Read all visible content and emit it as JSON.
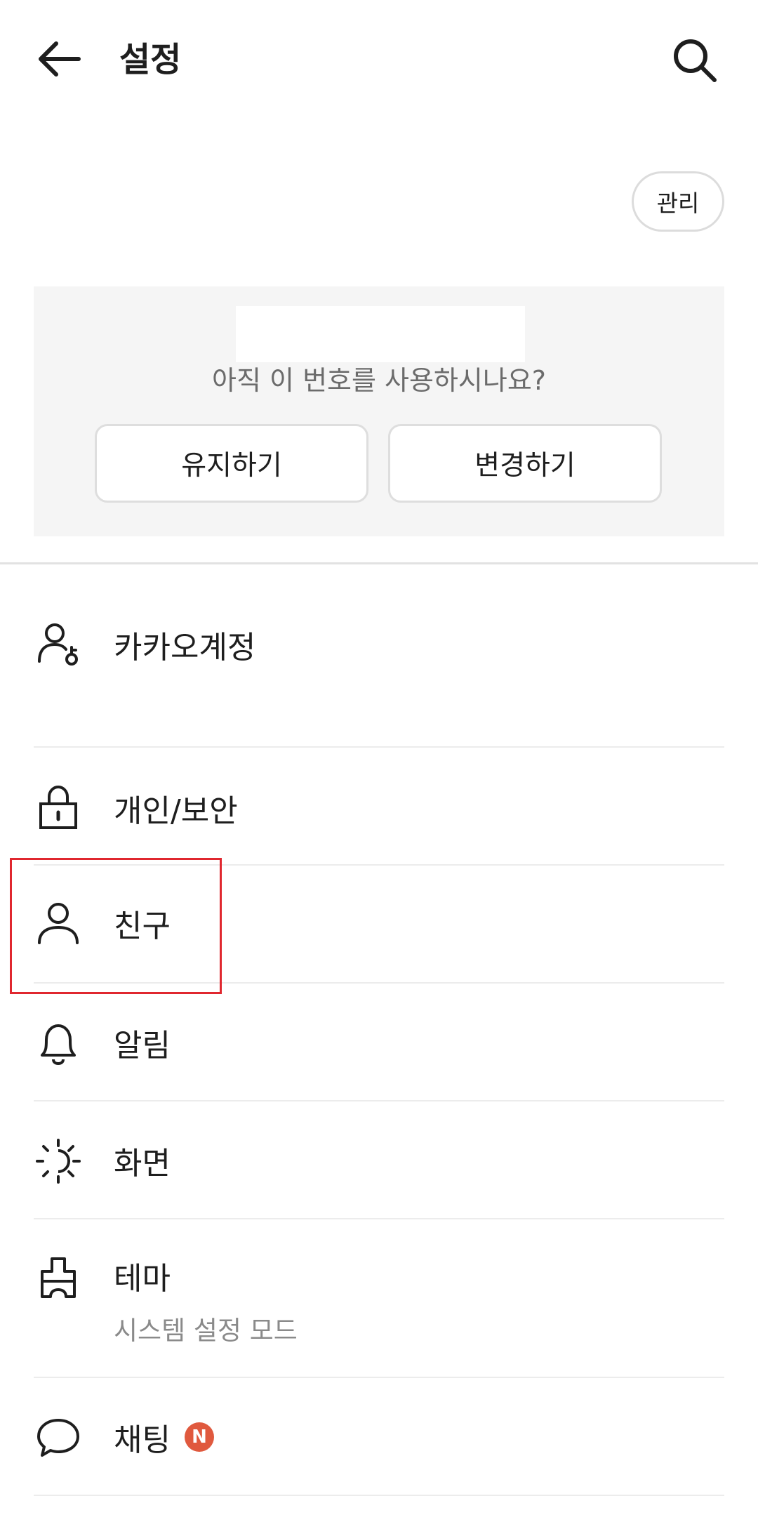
{
  "header": {
    "title": "설정"
  },
  "manage": {
    "label": "관리"
  },
  "phone_card": {
    "question": "아직 이 번호를 사용하시나요?",
    "keep_label": "유지하기",
    "change_label": "변경하기"
  },
  "menu": {
    "account": {
      "label": "카카오계정"
    },
    "privacy": {
      "label": "개인/보안"
    },
    "friends": {
      "label": "친구"
    },
    "notifications": {
      "label": "알림"
    },
    "display": {
      "label": "화면"
    },
    "theme": {
      "label": "테마",
      "sub": "시스템 설정 모드"
    },
    "chat": {
      "label": "채팅",
      "badge": "N"
    }
  },
  "colors": {
    "badge": "#e0593e",
    "highlight": "#e0272f",
    "card_bg": "#f5f5f5"
  }
}
